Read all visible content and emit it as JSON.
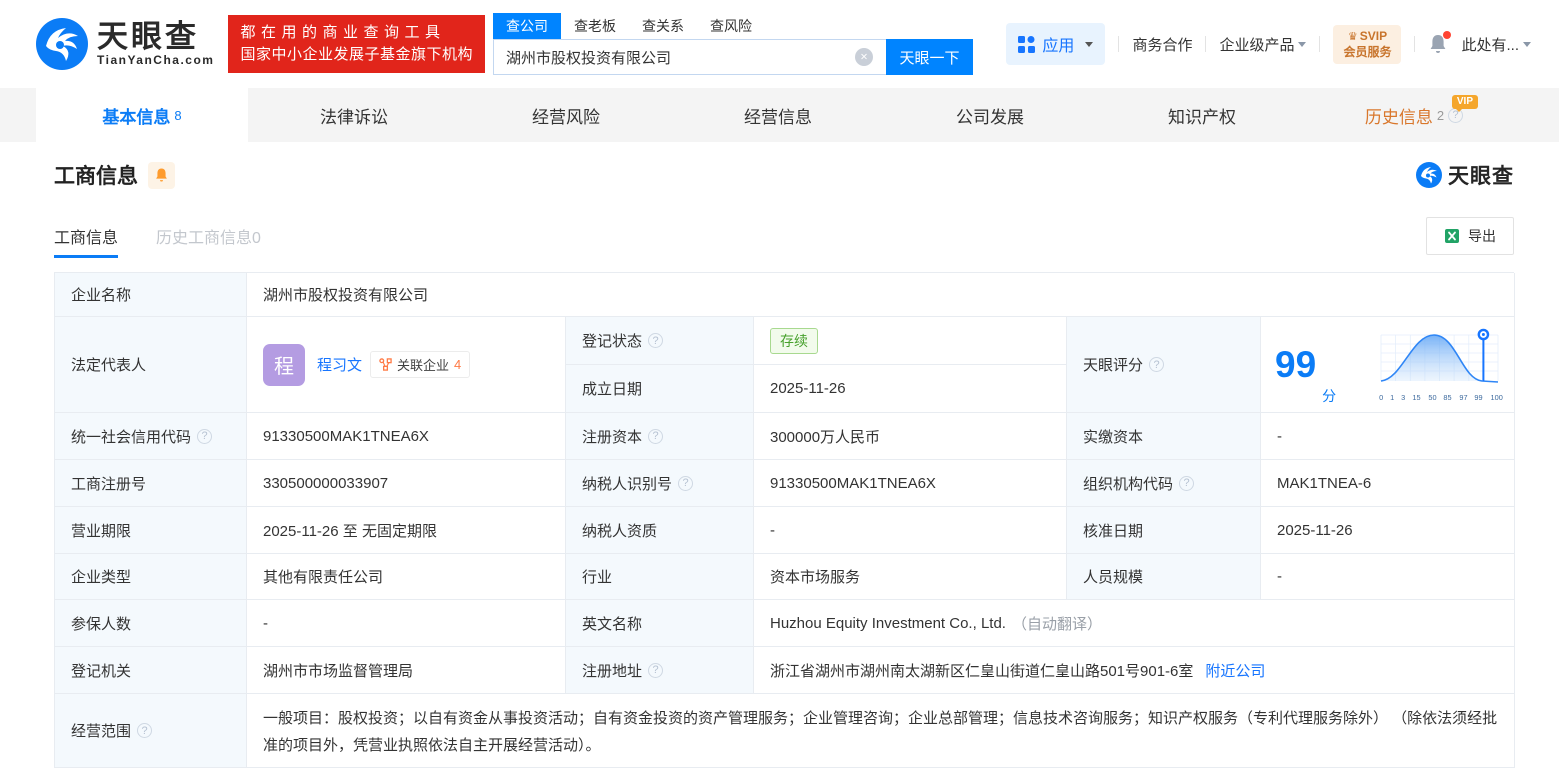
{
  "brand": {
    "name": "天眼查",
    "domain": "TianYanCha.com",
    "slogan_line1": "都在用的商业查询工具",
    "slogan_line2": "国家中小企业发展子基金旗下机构"
  },
  "search": {
    "tabs": [
      "查公司",
      "查老板",
      "查关系",
      "查风险"
    ],
    "value": "湖州市股权投资有限公司",
    "button": "天眼一下"
  },
  "topnav": {
    "apps": "应用",
    "cooperation": "商务合作",
    "enterprise": "企业级产品",
    "svip_top": "SVIP",
    "svip_bottom": "会员服务",
    "more": "此处有..."
  },
  "tabs": {
    "basic": "基本信息",
    "basic_count": "8",
    "legal": "法律诉讼",
    "risk": "经营风险",
    "operation": "经营信息",
    "development": "公司发展",
    "ip": "知识产权",
    "history": "历史信息",
    "history_count": "2",
    "history_vip": "VIP"
  },
  "section": {
    "title": "工商信息",
    "subtab_active": "工商信息",
    "subtab_history": "历史工商信息0",
    "export": "导出",
    "watermark": "天眼查"
  },
  "info": {
    "company_name_label": "企业名称",
    "company_name": "湖州市股权投资有限公司",
    "legal_rep_label": "法定代表人",
    "avatar_char": "程",
    "legal_rep_name": "程习文",
    "related_label": "关联企业",
    "related_count": "4",
    "status_label": "登记状态",
    "status_value": "存续",
    "founded_label": "成立日期",
    "founded_value": "2025-11-26",
    "score_label": "天眼评分",
    "score_value": "99",
    "score_unit": "分",
    "credit_code_label": "统一社会信用代码",
    "credit_code": "91330500MAK1TNEA6X",
    "reg_capital_label": "注册资本",
    "reg_capital": "300000万人民币",
    "paid_capital_label": "实缴资本",
    "paid_capital": "-",
    "reg_number_label": "工商注册号",
    "reg_number": "330500000033907",
    "taxpayer_id_label": "纳税人识别号",
    "taxpayer_id": "91330500MAK1TNEA6X",
    "org_code_label": "组织机构代码",
    "org_code": "MAK1TNEA-6",
    "term_label": "营业期限",
    "term": "2025-11-26 至 无固定期限",
    "taxpayer_quality_label": "纳税人资质",
    "taxpayer_quality": "-",
    "approval_date_label": "核准日期",
    "approval_date": "2025-11-26",
    "company_type_label": "企业类型",
    "company_type": "其他有限责任公司",
    "industry_label": "行业",
    "industry": "资本市场服务",
    "staff_size_label": "人员规模",
    "staff_size": "-",
    "insured_label": "参保人数",
    "insured": "-",
    "english_name_label": "英文名称",
    "english_name": "Huzhou Equity Investment Co., Ltd.",
    "english_name_note": "（自动翻译）",
    "registry_label": "登记机关",
    "registry": "湖州市市场监督管理局",
    "address_label": "注册地址",
    "address": "浙江省湖州市湖州南太湖新区仁皇山街道仁皇山路501号901-6室",
    "nearby_link": "附近公司",
    "scope_label": "经营范围",
    "scope": "一般项目：股权投资；以自有资金从事投资活动；自有资金投资的资产管理服务；企业管理咨询；企业总部管理；信息技术咨询服务；知识产权服务（专利代理服务除外） （除依法须经批准的项目外，凭营业执照依法自主开展经营活动）。"
  },
  "score_chart": {
    "type": "area",
    "description": "bell-curve score distribution with marker pin at score",
    "score": 99,
    "ticks": [
      "0",
      "1",
      "3",
      "15",
      "50",
      "85",
      "97",
      "99",
      "100"
    ]
  },
  "colors": {
    "primary_blue": "#0084ff",
    "link_blue": "#1775ff",
    "status_green": "#47a12c",
    "accent_orange": "#d9772c",
    "banner_red": "#e1251b"
  }
}
